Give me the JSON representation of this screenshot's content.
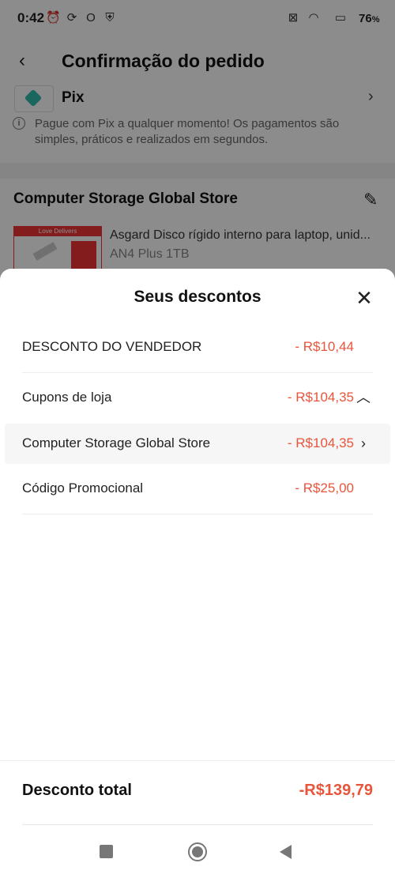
{
  "status_bar": {
    "time": "0:42",
    "battery": "76",
    "battery_suffix": "%"
  },
  "background_page": {
    "title": "Confirmação do pedido",
    "payment_method": "Pix",
    "pix_info": "Pague com Pix a qualquer momento! Os pagamentos são simples, práticos e realizados em segundos.",
    "store_name": "Computer Storage Global Store",
    "product": {
      "thumb_label": "Love Delivers",
      "name": "Asgard Disco rígido interno para laptop, unid...",
      "variant": "AN4 Plus 1TB"
    }
  },
  "sheet": {
    "title": "Seus descontos",
    "rows": [
      {
        "label": "DESCONTO DO VENDEDOR",
        "value": "- R$10,44"
      },
      {
        "label": "Cupons de loja",
        "value": "- R$104,35"
      },
      {
        "label": "Computer Storage Global Store",
        "value": "- R$104,35"
      },
      {
        "label": "Código Promocional",
        "value": "- R$25,00"
      }
    ],
    "total_label": "Desconto total",
    "total_value": "-R$139,79"
  },
  "colors": {
    "accent": "#e8553b",
    "pix": "#32bcad"
  }
}
